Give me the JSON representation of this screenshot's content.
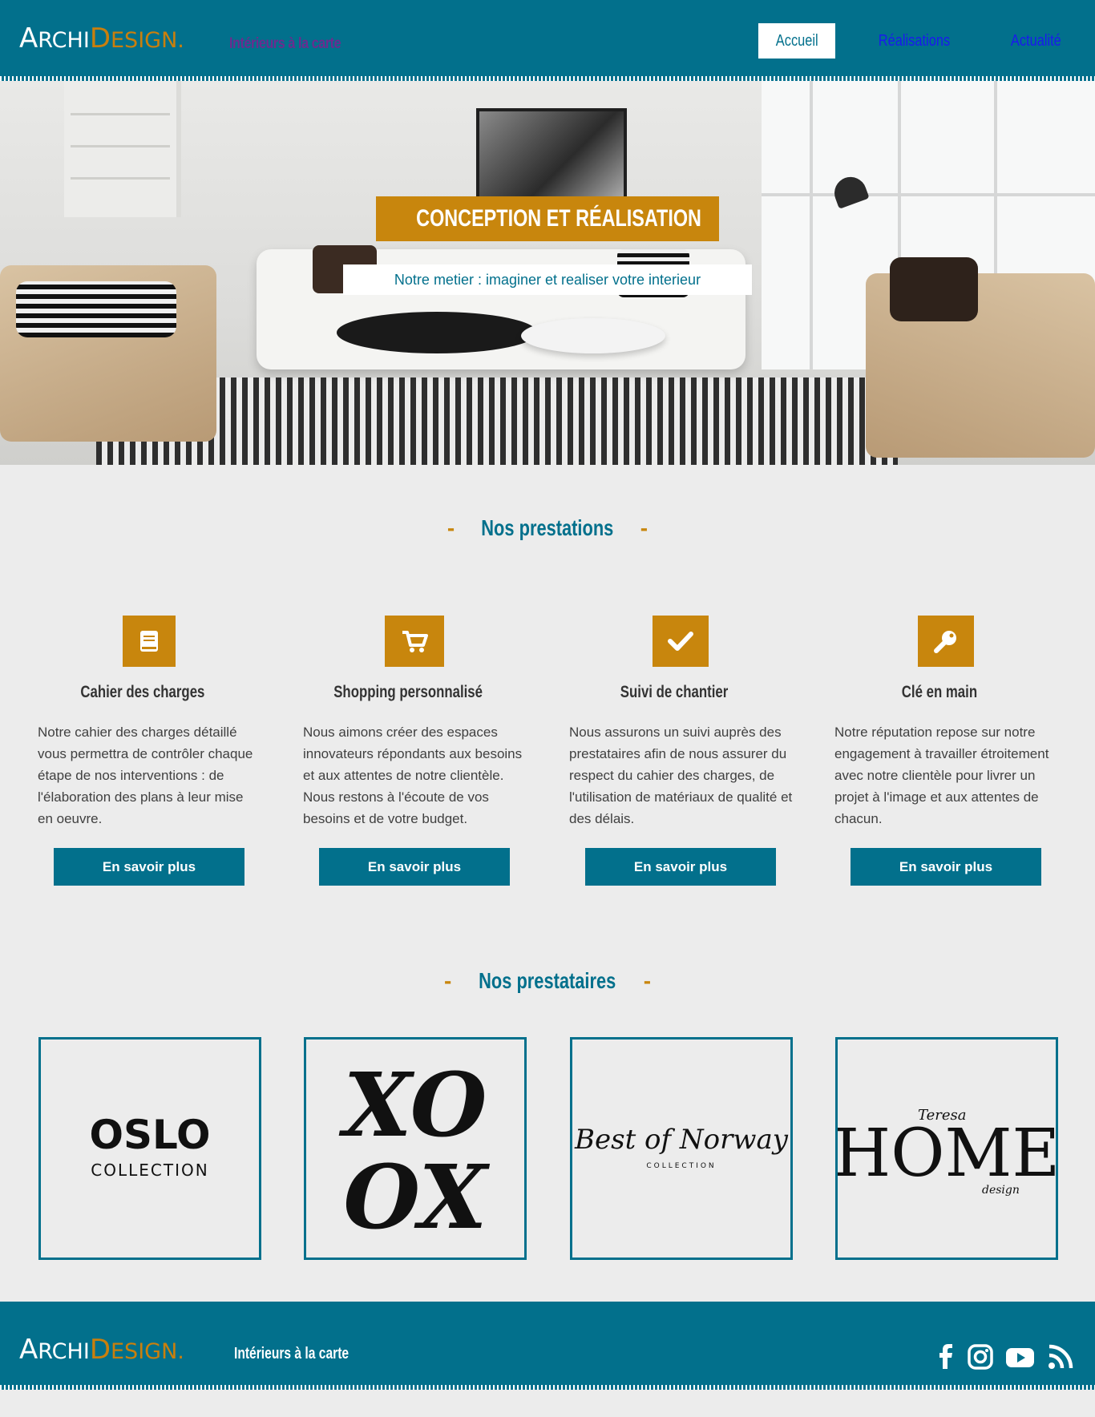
{
  "header": {
    "logo": {
      "part1_cap": "A",
      "part1_rest": "RCHI",
      "part2_cap": "D",
      "part2_rest": "ESIGN."
    },
    "tagline": "Intérieurs à la carte",
    "nav": [
      {
        "label": "Accueil",
        "active": true
      },
      {
        "label": "Réalisations",
        "active": false
      },
      {
        "label": "Actualité",
        "active": false
      }
    ]
  },
  "hero": {
    "title": "CONCEPTION ET RÉALISATION",
    "subtitle": "Notre metier : imaginer et realiser votre interieur"
  },
  "prestations": {
    "title": "Nos prestations",
    "dash": "-",
    "items": [
      {
        "icon": "book-icon",
        "title": "Cahier des charges",
        "text": "Notre cahier des charges détaillé vous permettra de contrôler chaque étape de nos interventions : de l'élaboration des plans à leur mise en oeuvre.",
        "button": "En savoir plus"
      },
      {
        "icon": "shopping-cart-icon",
        "title": "Shopping personnalisé",
        "text": "Nous aimons créer des espaces innovateurs répondants aux besoins et aux attentes de notre clientèle. Nous restons à l'écoute de vos besoins et de votre budget.",
        "button": "En savoir plus"
      },
      {
        "icon": "check-icon",
        "title": "Suivi de chantier",
        "text": "Nous assurons un suivi auprès des prestataires afin de nous assurer du respect du cahier des charges, de l'utilisation de matériaux de qualité et des délais.",
        "button": "En savoir plus"
      },
      {
        "icon": "key-icon",
        "title": "Clé en main",
        "text": "Notre réputation repose sur notre engagement à travailler étroitement avec notre clientèle pour livrer un projet à l'image et aux attentes de chacun.",
        "button": "En savoir plus"
      }
    ]
  },
  "prestataires": {
    "title": "Nos prestataires",
    "dash": "-",
    "partners": [
      {
        "name": "OSLO",
        "sub": "COLLECTION"
      },
      {
        "name_line1": "XO",
        "name_line2": "OX"
      },
      {
        "name": "Best of Norway",
        "sub": "COLLECTION"
      },
      {
        "name": "HOME",
        "script_top": "Teresa",
        "script_bottom": "design"
      }
    ]
  },
  "footer": {
    "tagline": "Intérieurs à la carte",
    "social": [
      "facebook-icon",
      "instagram-icon",
      "youtube-icon",
      "rss-icon"
    ]
  },
  "colors": {
    "primary": "#02708c",
    "accent": "#c8860d",
    "background": "#ececec",
    "tagline_purple": "#6b2c8f",
    "link_blue": "#1a1aee"
  }
}
